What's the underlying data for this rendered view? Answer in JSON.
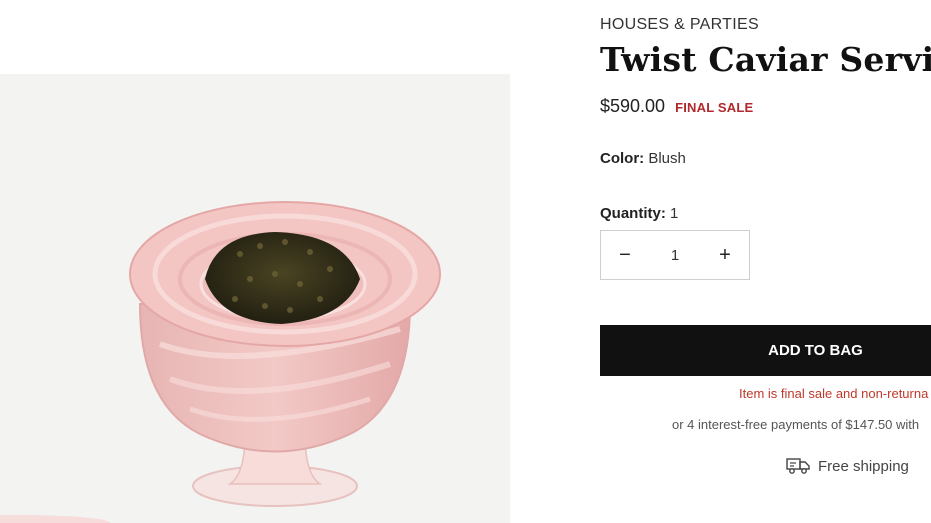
{
  "product": {
    "brand": "HOUSES & PARTIES",
    "title": "Twist Caviar Service C",
    "price": "$590.00",
    "sale_badge": "FINAL SALE",
    "color_label": "Color:",
    "color_value": "Blush",
    "quantity_label": "Quantity:",
    "quantity_value": "1"
  },
  "stepper": {
    "minus": "−",
    "value": "1",
    "plus": "+"
  },
  "actions": {
    "add_to_bag": "ADD TO BAG"
  },
  "notes": {
    "final_sale_note": "Item is final sale and non-returna",
    "payments": "or 4 interest-free payments of $147.50 with",
    "shipping": "Free shipping"
  },
  "icons": {
    "shipping": "truck-icon"
  },
  "colors": {
    "button_bg": "#111111",
    "sale_red": "#b0282b",
    "image_bg": "#f3f3f1"
  }
}
